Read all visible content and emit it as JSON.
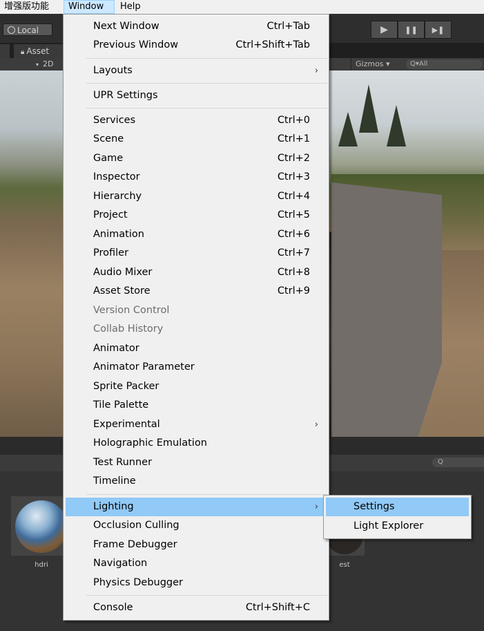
{
  "menubar": {
    "items": [
      "增强版功能",
      "Window",
      "Help"
    ]
  },
  "toolbar": {
    "local_label": "Local",
    "play_icons": [
      "▶",
      "❚❚",
      "▶❚"
    ]
  },
  "asset_tab": {
    "label": "Asset"
  },
  "scene_toolbar": {
    "mode_2d": "2D",
    "gizmos": "Gizmos ▾",
    "search_placeholder": "Q▾All"
  },
  "project": {
    "search_placeholder": "Q",
    "assets": [
      {
        "name": "hdri"
      },
      {
        "name": "est"
      }
    ]
  },
  "window_menu": {
    "items": [
      {
        "label": "Next Window",
        "shortcut": "Ctrl+Tab"
      },
      {
        "label": "Previous Window",
        "shortcut": "Ctrl+Shift+Tab"
      },
      {
        "label": "Layouts",
        "submenu": true
      },
      {
        "label": "UPR Settings"
      },
      {
        "label": "Services",
        "shortcut": "Ctrl+0"
      },
      {
        "label": "Scene",
        "shortcut": "Ctrl+1"
      },
      {
        "label": "Game",
        "shortcut": "Ctrl+2"
      },
      {
        "label": "Inspector",
        "shortcut": "Ctrl+3"
      },
      {
        "label": "Hierarchy",
        "shortcut": "Ctrl+4"
      },
      {
        "label": "Project",
        "shortcut": "Ctrl+5"
      },
      {
        "label": "Animation",
        "shortcut": "Ctrl+6"
      },
      {
        "label": "Profiler",
        "shortcut": "Ctrl+7"
      },
      {
        "label": "Audio Mixer",
        "shortcut": "Ctrl+8"
      },
      {
        "label": "Asset Store",
        "shortcut": "Ctrl+9"
      },
      {
        "label": "Version Control",
        "disabled": true
      },
      {
        "label": "Collab History",
        "disabled": true
      },
      {
        "label": "Animator"
      },
      {
        "label": "Animator Parameter"
      },
      {
        "label": "Sprite Packer"
      },
      {
        "label": "Tile Palette"
      },
      {
        "label": "Experimental",
        "submenu": true
      },
      {
        "label": "Holographic Emulation"
      },
      {
        "label": "Test Runner"
      },
      {
        "label": "Timeline"
      },
      {
        "label": "Lighting",
        "submenu": true,
        "highlighted": true
      },
      {
        "label": "Occlusion Culling"
      },
      {
        "label": "Frame Debugger"
      },
      {
        "label": "Navigation"
      },
      {
        "label": "Physics Debugger"
      },
      {
        "label": "Console",
        "shortcut": "Ctrl+Shift+C"
      }
    ],
    "submenu_arrow": "›"
  },
  "lighting_submenu": {
    "items": [
      {
        "label": "Settings",
        "highlighted": true
      },
      {
        "label": "Light Explorer"
      }
    ]
  },
  "colors": {
    "menu_bg": "#f0f0f0",
    "highlight": "#91c9f7",
    "disabled_text": "#6d6d6d"
  }
}
